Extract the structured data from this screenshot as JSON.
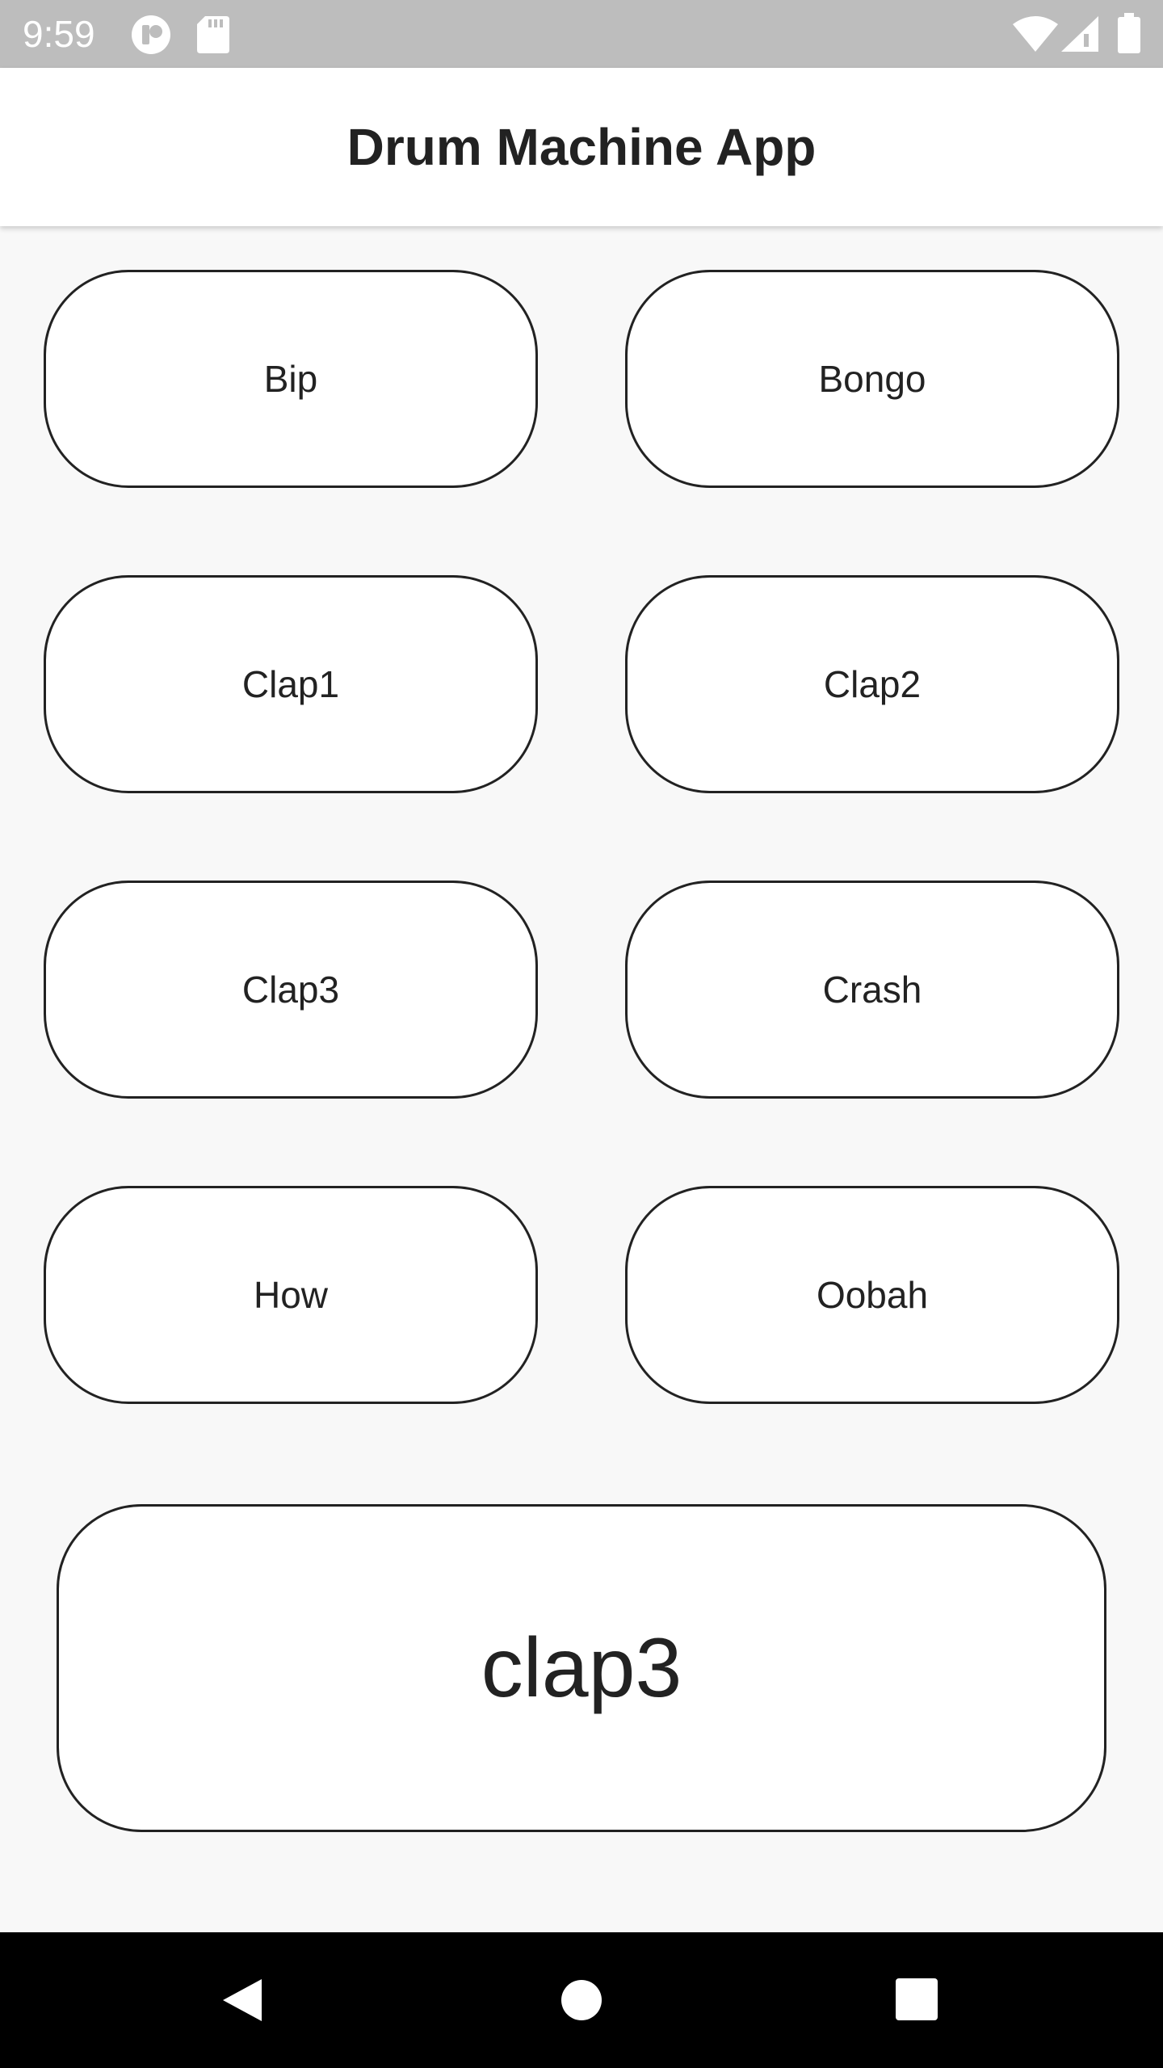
{
  "status_bar": {
    "time": "9:59",
    "icons": [
      "notification-icon",
      "sd-card-icon",
      "wifi-icon",
      "cell-signal-icon",
      "battery-icon"
    ]
  },
  "app_bar": {
    "title": "Drum Machine App"
  },
  "pads": [
    {
      "label": "Bip"
    },
    {
      "label": "Bongo"
    },
    {
      "label": "Clap1"
    },
    {
      "label": "Clap2"
    },
    {
      "label": "Clap3"
    },
    {
      "label": "Crash"
    },
    {
      "label": "How"
    },
    {
      "label": "Oobah"
    }
  ],
  "display": {
    "text": "clap3"
  },
  "nav_bar": {
    "icons": [
      "back-icon",
      "home-icon",
      "recents-icon"
    ]
  },
  "colors": {
    "status_bar": "#bdbdbd",
    "background": "#f8f8f8",
    "surface": "#ffffff",
    "text": "#222222",
    "nav_bar": "#000000"
  }
}
